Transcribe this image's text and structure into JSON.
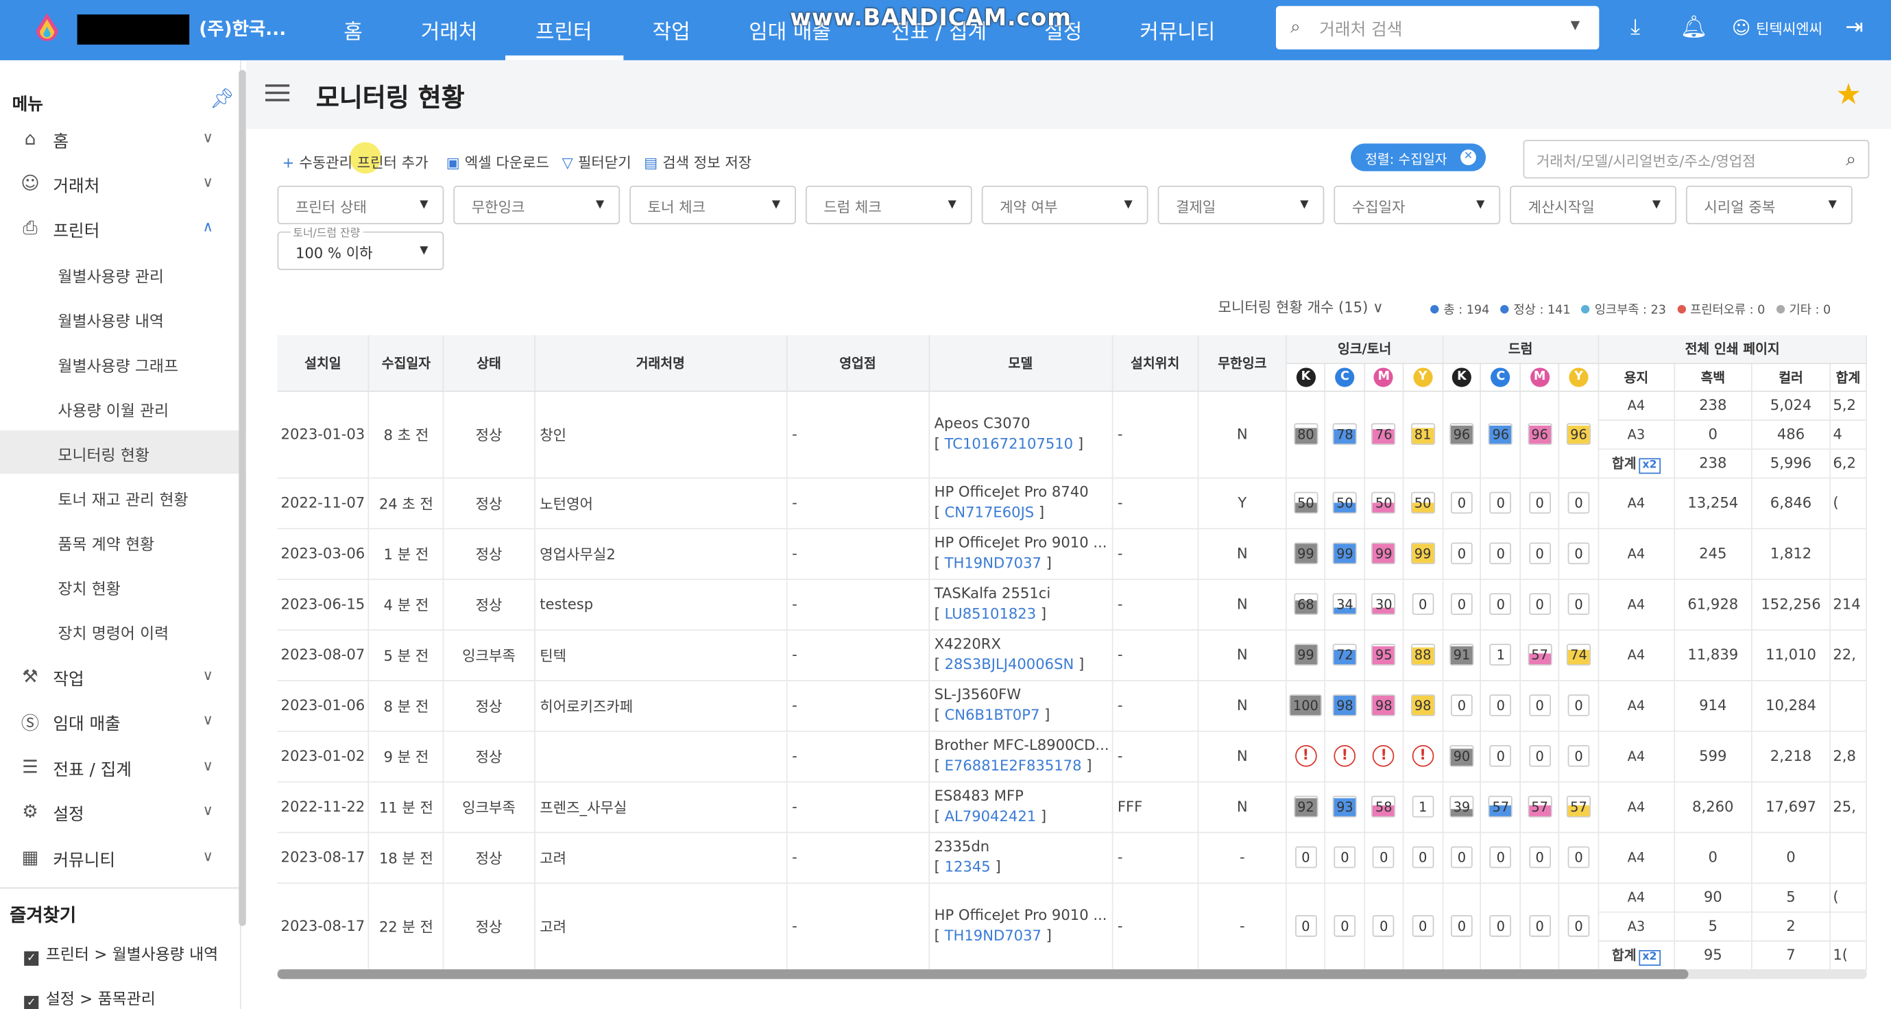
{
  "topbar": {
    "company": "(주)한국...",
    "nav": [
      "홈",
      "거래처",
      "프린터",
      "작업",
      "임대 매출",
      "전표 / 집계",
      "설정",
      "커뮤니티"
    ],
    "active_nav": "프린터",
    "watermark": "www.BANDICAM.com",
    "search_placeholder": "거래처 검색",
    "user": "틴텍씨엔씨"
  },
  "sidebar": {
    "title": "메뉴",
    "items": [
      {
        "label": "홈",
        "icon": "home-icon",
        "expanded": false
      },
      {
        "label": "거래처",
        "icon": "person-icon",
        "expanded": false
      },
      {
        "label": "프린터",
        "icon": "printer-icon",
        "expanded": true
      },
      {
        "label": "작업",
        "icon": "tools-icon",
        "expanded": false
      },
      {
        "label": "임대 매출",
        "icon": "dollar-icon",
        "expanded": false
      },
      {
        "label": "전표 / 집계",
        "icon": "document-icon",
        "expanded": false
      },
      {
        "label": "설정",
        "icon": "gear-icon",
        "expanded": false
      },
      {
        "label": "커뮤니티",
        "icon": "building-icon",
        "expanded": false
      }
    ],
    "printer_sub": [
      "월별사용량 관리",
      "월별사용량 내역",
      "월별사용량 그래프",
      "사용량 이월 관리",
      "모니터링 현황",
      "토너 재고 관리 현황",
      "품목 계약 현황",
      "장치 현황",
      "장치 명령어 이력"
    ],
    "active_sub": "모니터링 현황",
    "favorites_title": "즐겨찾기",
    "favorites": [
      "프린터 > 월별사용량 내역",
      "설정 > 품목관리"
    ]
  },
  "page": {
    "title": "모니터링 현황",
    "toolbar": {
      "add_label": "수동관리 프린터 추가",
      "excel_label": "엑셀 다운로드",
      "filter_label": "필터닫기",
      "save_label": "검색 정보 저장"
    },
    "sort_chip": "정렬: 수집일자",
    "search_placeholder": "거래처/모델/시리얼번호/주소/영업점",
    "filters": [
      "프린터 상태",
      "무한잉크",
      "토너 체크",
      "드럼 체크",
      "계약 여부",
      "결제일",
      "수집일자",
      "계산시작일",
      "시리얼 중복"
    ],
    "filter_level": {
      "label": "토너/드럼 잔량",
      "value": "100 % 이하"
    },
    "count_label": "모니터링 현황 개수 (15)",
    "legend": [
      {
        "label": "총 : 194",
        "color": "#3a7bd5"
      },
      {
        "label": "정상 : 141",
        "color": "#3a7bd5"
      },
      {
        "label": "잉크부족 : 23",
        "color": "#5ab0d8"
      },
      {
        "label": "프린터오류 : 0",
        "color": "#e05a4f"
      },
      {
        "label": "기타 : 0",
        "color": "#aaaaaa"
      }
    ]
  },
  "table": {
    "headers": [
      "설치일",
      "수집일자",
      "상태",
      "거래처명",
      "영업점",
      "모델",
      "설치위치",
      "무한잉크",
      "잉크/토너",
      "드럼",
      "전체 인쇄 페이지"
    ],
    "color_labels": [
      "K",
      "C",
      "M",
      "Y"
    ],
    "color_hex": {
      "K": "#222222",
      "C": "#2f7fe0",
      "M": "#e0579e",
      "Y": "#f2c12e"
    },
    "fill_hex": {
      "K": "#8a8a8a",
      "C": "#4f93e6",
      "M": "#ea7ab6",
      "Y": "#f7d04a"
    },
    "page_headers": [
      "용지",
      "흑백",
      "컬러",
      "합계"
    ],
    "total_label": "합계",
    "x2_label": "x2",
    "rows": [
      {
        "install": "2023-01-03",
        "collected": "8 초 전",
        "status": "정상",
        "client": "창인",
        "branch": "-",
        "model": "Apeos C3070",
        "serial": "TC101672107510",
        "location": "-",
        "infinite": "N",
        "ink": [
          "80",
          "78",
          "76",
          "81"
        ],
        "drum": [
          "96",
          "96",
          "96",
          "96"
        ],
        "pages": [
          {
            "paper": "A4",
            "bw": "238",
            "color": "5,024",
            "total": "5,2"
          },
          {
            "paper": "A3",
            "bw": "0",
            "color": "486",
            "total": "4"
          },
          {
            "paper": "합계",
            "bw": "238",
            "color": "5,996",
            "total": "6,2",
            "x2": true
          }
        ]
      },
      {
        "install": "2022-11-07",
        "collected": "24 초 전",
        "status": "정상",
        "client": "노턴영어",
        "branch": "-",
        "model": "HP OfficeJet Pro 8740",
        "serial": "CN717E60JS",
        "location": "-",
        "infinite": "Y",
        "ink": [
          "50",
          "50",
          "50",
          "50"
        ],
        "drum": [
          "0",
          "0",
          "0",
          "0"
        ],
        "pages": [
          {
            "paper": "A4",
            "bw": "13,254",
            "color": "6,846",
            "total": "("
          }
        ]
      },
      {
        "install": "2023-03-06",
        "collected": "1 분 전",
        "status": "정상",
        "client": "영업사무실2",
        "branch": "-",
        "model": "HP OfficeJet Pro 9010 ...",
        "serial": "TH19ND7037",
        "location": "-",
        "infinite": "N",
        "ink": [
          "99",
          "99",
          "99",
          "99"
        ],
        "drum": [
          "0",
          "0",
          "0",
          "0"
        ],
        "pages": [
          {
            "paper": "A4",
            "bw": "245",
            "color": "1,812",
            "total": ""
          }
        ]
      },
      {
        "install": "2023-06-15",
        "collected": "4 분 전",
        "status": "정상",
        "client": "testesp",
        "branch": "-",
        "model": "TASKalfa 2551ci",
        "serial": "LU85101823",
        "location": "-",
        "infinite": "N",
        "ink": [
          "68",
          "34",
          "30",
          "0"
        ],
        "drum": [
          "0",
          "0",
          "0",
          "0"
        ],
        "pages": [
          {
            "paper": "A4",
            "bw": "61,928",
            "color": "152,256",
            "total": "214"
          }
        ]
      },
      {
        "install": "2023-08-07",
        "collected": "5 분 전",
        "status": "잉크부족",
        "client": "틴텍",
        "branch": "-",
        "model": "X4220RX",
        "serial": "28S3BJLJ40006SN",
        "location": "-",
        "infinite": "N",
        "ink": [
          "99",
          "72",
          "95",
          "88"
        ],
        "drum": [
          "91",
          "1",
          "57",
          "74"
        ],
        "pages": [
          {
            "paper": "A4",
            "bw": "11,839",
            "color": "11,010",
            "total": "22,"
          }
        ]
      },
      {
        "install": "2023-01-06",
        "collected": "8 분 전",
        "status": "정상",
        "client": "히어로키즈카페",
        "branch": "-",
        "model": "SL-J3560FW",
        "serial": "CN6B1BT0P7",
        "location": "-",
        "infinite": "N",
        "ink": [
          "100",
          "98",
          "98",
          "98"
        ],
        "drum": [
          "0",
          "0",
          "0",
          "0"
        ],
        "pages": [
          {
            "paper": "A4",
            "bw": "914",
            "color": "10,284",
            "total": ""
          }
        ]
      },
      {
        "install": "2023-01-02",
        "collected": "9 분 전",
        "status": "정상",
        "client": "",
        "branch": "-",
        "model": "Brother MFC-L8900CD...",
        "serial": "E76881E2F835178",
        "location": "-",
        "infinite": "N",
        "ink": [
          "!",
          "!",
          "!",
          "!"
        ],
        "drum": [
          "90",
          "0",
          "0",
          "0"
        ],
        "pages": [
          {
            "paper": "A4",
            "bw": "599",
            "color": "2,218",
            "total": "2,8"
          }
        ]
      },
      {
        "install": "2022-11-22",
        "collected": "11 분 전",
        "status": "잉크부족",
        "client": "프렌즈_사무실",
        "branch": "-",
        "model": "ES8483 MFP",
        "serial": "AL79042421",
        "location": "FFF",
        "infinite": "N",
        "ink": [
          "92",
          "93",
          "58",
          "1"
        ],
        "drum": [
          "39",
          "57",
          "57",
          "57"
        ],
        "pages": [
          {
            "paper": "A4",
            "bw": "8,260",
            "color": "17,697",
            "total": "25,"
          }
        ]
      },
      {
        "install": "2023-08-17",
        "collected": "18 분 전",
        "status": "정상",
        "client": "고려",
        "branch": "-",
        "model": "2335dn",
        "serial": "12345",
        "location": "-",
        "infinite": "-",
        "ink": [
          "0",
          "0",
          "0",
          "0"
        ],
        "drum": [
          "0",
          "0",
          "0",
          "0"
        ],
        "pages": [
          {
            "paper": "A4",
            "bw": "0",
            "color": "0",
            "total": ""
          }
        ]
      },
      {
        "install": "2023-08-17",
        "collected": "22 분 전",
        "status": "정상",
        "client": "고려",
        "branch": "-",
        "model": "HP OfficeJet Pro 9010 ...",
        "serial": "TH19ND7037",
        "location": "-",
        "infinite": "-",
        "ink": [
          "0",
          "0",
          "0",
          "0"
        ],
        "drum": [
          "0",
          "0",
          "0",
          "0"
        ],
        "pages": [
          {
            "paper": "A4",
            "bw": "90",
            "color": "5",
            "total": "("
          },
          {
            "paper": "A3",
            "bw": "5",
            "color": "2",
            "total": ""
          },
          {
            "paper": "합계",
            "bw": "95",
            "color": "7",
            "total": "1(",
            "x2": true
          }
        ]
      }
    ]
  }
}
